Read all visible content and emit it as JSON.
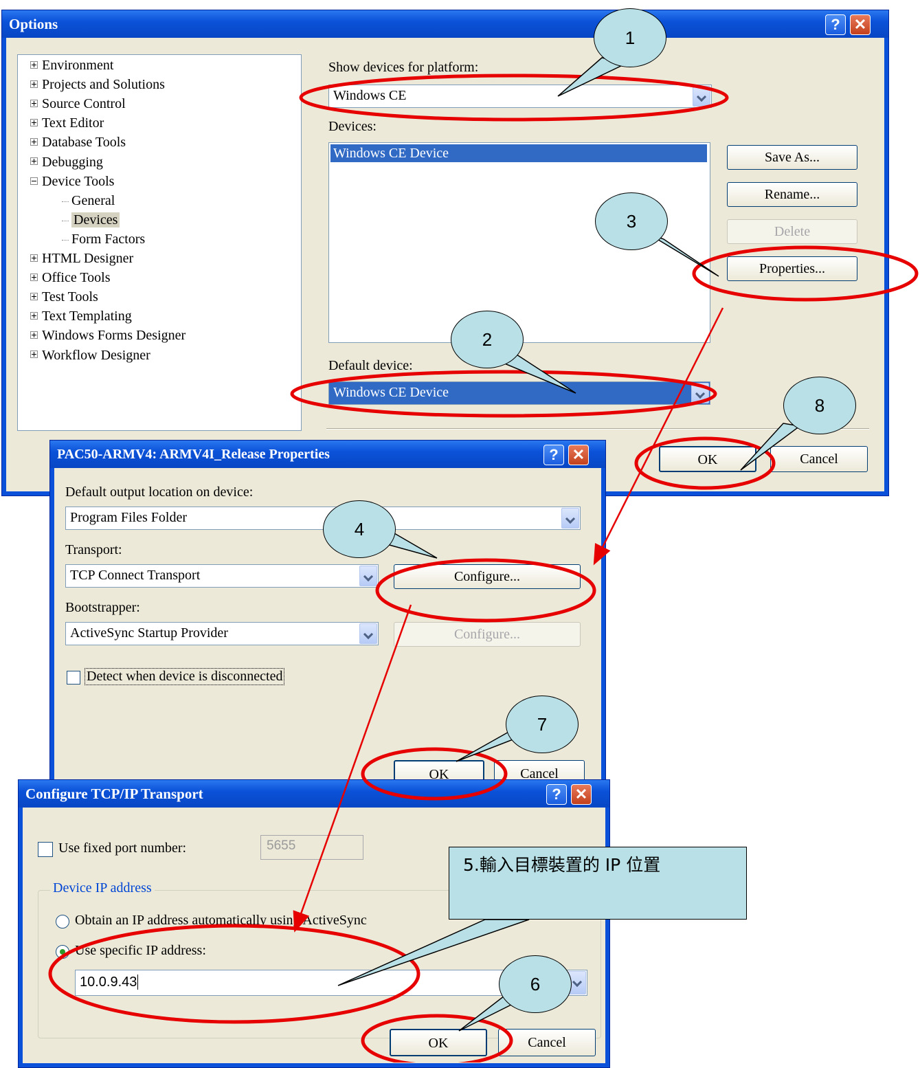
{
  "options": {
    "title": "Options",
    "tree": [
      {
        "label": "Environment",
        "expander": "plus"
      },
      {
        "label": "Projects and Solutions",
        "expander": "plus"
      },
      {
        "label": "Source Control",
        "expander": "plus"
      },
      {
        "label": "Text Editor",
        "expander": "plus"
      },
      {
        "label": "Database Tools",
        "expander": "plus"
      },
      {
        "label": "Debugging",
        "expander": "plus"
      },
      {
        "label": "Device Tools",
        "expander": "minus"
      },
      {
        "label": "General",
        "expander": "child"
      },
      {
        "label": "Devices",
        "expander": "child",
        "selected": true
      },
      {
        "label": "Form Factors",
        "expander": "child"
      },
      {
        "label": "HTML Designer",
        "expander": "plus"
      },
      {
        "label": "Office Tools",
        "expander": "plus"
      },
      {
        "label": "Test Tools",
        "expander": "plus"
      },
      {
        "label": "Text Templating",
        "expander": "plus"
      },
      {
        "label": "Windows Forms Designer",
        "expander": "plus"
      },
      {
        "label": "Workflow Designer",
        "expander": "plus"
      }
    ],
    "platform_label": "Show devices for platform:",
    "platform_value": "Windows CE",
    "devices_label": "Devices:",
    "devices_list": [
      "Windows CE Device"
    ],
    "save_as": "Save As...",
    "rename": "Rename...",
    "delete": "Delete",
    "properties": "Properties...",
    "default_device_label": "Default device:",
    "default_device_value": "Windows CE Device",
    "ok": "OK",
    "cancel": "Cancel"
  },
  "properties_dialog": {
    "title": "PAC50-ARMV4: ARMV4I_Release Properties",
    "output_label": "Default output location on device:",
    "output_value": "Program Files Folder",
    "transport_label": "Transport:",
    "transport_value": "TCP Connect Transport",
    "configure": "Configure...",
    "bootstrapper_label": "Bootstrapper:",
    "bootstrapper_value": "ActiveSync Startup Provider",
    "configure_disabled": "Configure...",
    "detect_label": "Detect when device is disconnected",
    "ok": "OK",
    "cancel": "Cancel"
  },
  "tcp_dialog": {
    "title": "Configure TCP/IP Transport",
    "fixed_port_label": "Use fixed port number:",
    "port_value": "5655",
    "group_label": "Device IP address",
    "obtain_label": "Obtain an IP address automatically using ActiveSync",
    "specific_label": "Use specific IP address:",
    "ip_value": "10.0.9.43",
    "ok": "OK",
    "cancel": "Cancel"
  },
  "annotations": {
    "step1": "1",
    "step2": "2",
    "step3": "3",
    "step4": "4",
    "step5_note": "5.輸入目標裝置的 IP 位置",
    "step6": "6",
    "step7": "7",
    "step8": "8",
    "highlight_color": "#e60000",
    "bubble_color": "#b8e0e6"
  }
}
